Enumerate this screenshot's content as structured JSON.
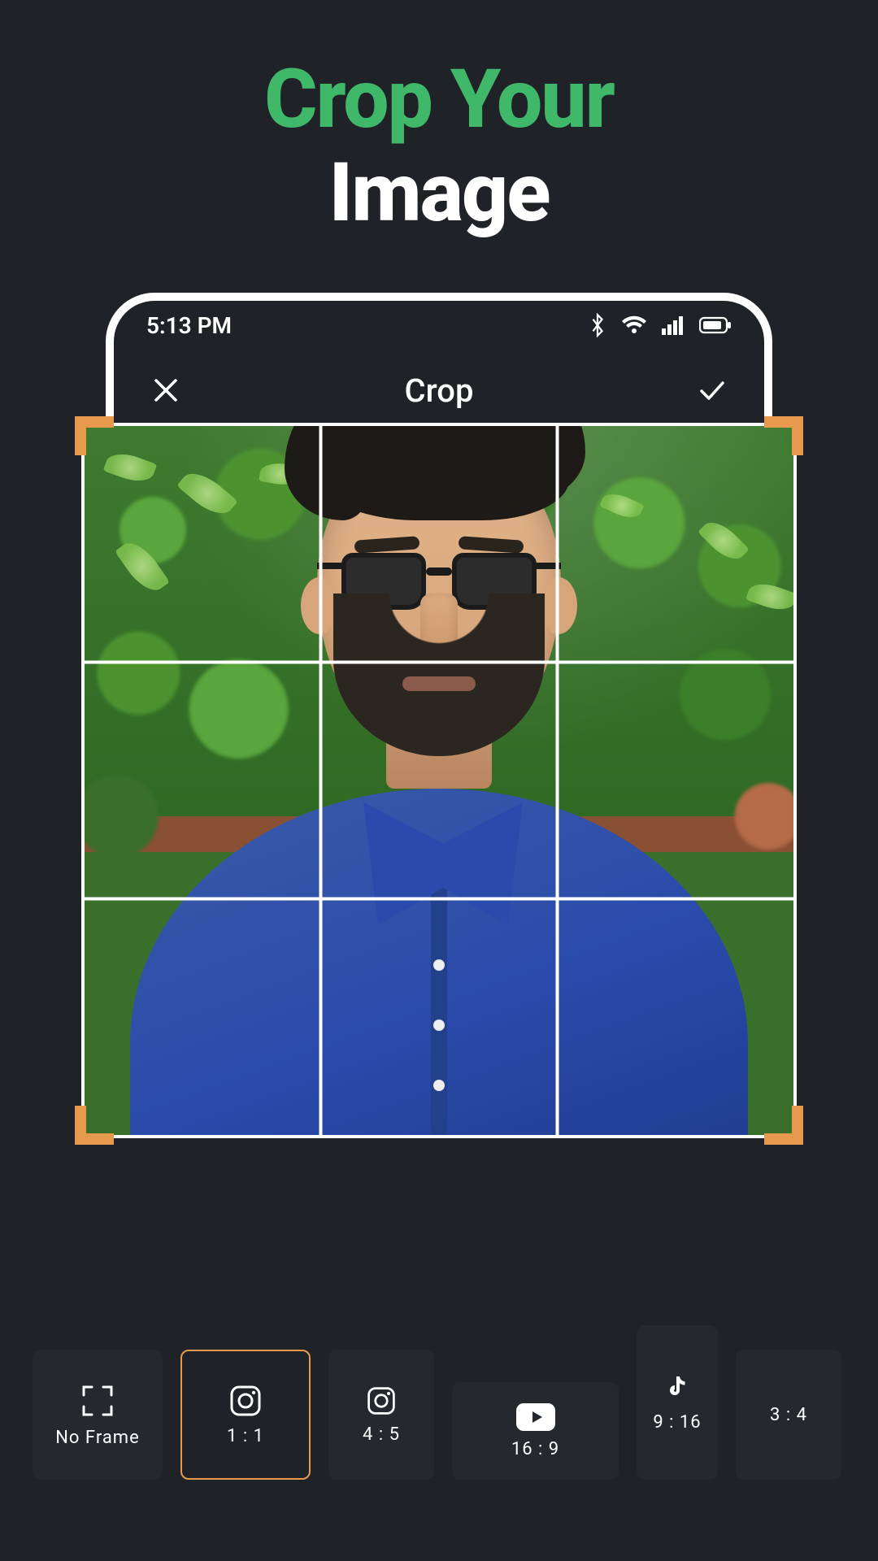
{
  "headline": {
    "line1": "Crop Your",
    "line2": "Image",
    "accent_color": "#3fb86a"
  },
  "statusbar": {
    "time": "5:13 PM",
    "icons": {
      "bluetooth": "bluetooth-icon",
      "wifi": "wifi-icon",
      "cell": "cell-signal-icon",
      "battery": "battery-icon"
    }
  },
  "topbar": {
    "title": "Crop",
    "close_icon": "close-icon",
    "confirm_icon": "check-icon"
  },
  "crop": {
    "grid": "rule-of-thirds",
    "handle_color": "#e79a4d"
  },
  "ratios": [
    {
      "id": "noframe",
      "label": "No Frame",
      "icon": "fullscreen-icon",
      "selected": false
    },
    {
      "id": "1_1",
      "label": "1 : 1",
      "icon": "instagram-icon",
      "selected": true
    },
    {
      "id": "4_5",
      "label": "4 : 5",
      "icon": "instagram-icon",
      "selected": false
    },
    {
      "id": "16_9",
      "label": "16 : 9",
      "icon": "youtube-icon",
      "selected": false
    },
    {
      "id": "9_16",
      "label": "9 : 16",
      "icon": "tiktok-icon",
      "selected": false
    },
    {
      "id": "3_4",
      "label": "3 : 4",
      "icon": "",
      "selected": false
    }
  ]
}
